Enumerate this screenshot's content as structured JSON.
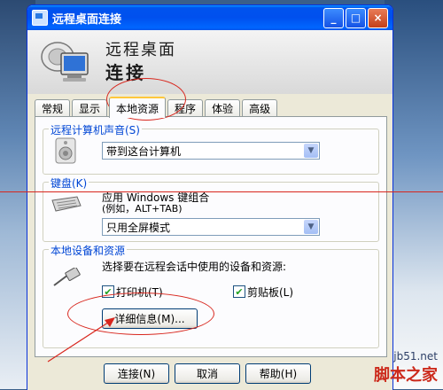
{
  "window": {
    "title": "远程桌面连接",
    "buttons": [
      "_",
      "□",
      "×"
    ]
  },
  "header": {
    "line1": "远程桌面",
    "line2": "连接"
  },
  "tabs": [
    {
      "label": "常规"
    },
    {
      "label": "显示"
    },
    {
      "label": "本地资源",
      "active": true
    },
    {
      "label": "程序"
    },
    {
      "label": "体验"
    },
    {
      "label": "高级"
    }
  ],
  "sound_group": {
    "title": "远程计算机声音(S)",
    "value": "带到这台计算机"
  },
  "keyboard_group": {
    "title": "键盘(K)",
    "desc_line1": "应用 Windows 键组合",
    "desc_line2": "(例如，ALT+TAB)",
    "value": "只用全屏模式"
  },
  "devices_group": {
    "title": "本地设备和资源",
    "desc": "选择要在远程会话中使用的设备和资源:",
    "printers_label": "打印机(T)",
    "printers_checked": true,
    "clipboard_label": "剪贴板(L)",
    "clipboard_checked": true,
    "details_button": "详细信息(M)..."
  },
  "footer": {
    "connect": "连接(N)",
    "cancel": "取消",
    "help": "帮助(H)"
  },
  "watermark": {
    "site": "jb51.net",
    "name": "脚本之家"
  },
  "colors": {
    "title_bar": "#0054e3",
    "group_title": "#0046d5",
    "annotation": "#d8261d"
  }
}
